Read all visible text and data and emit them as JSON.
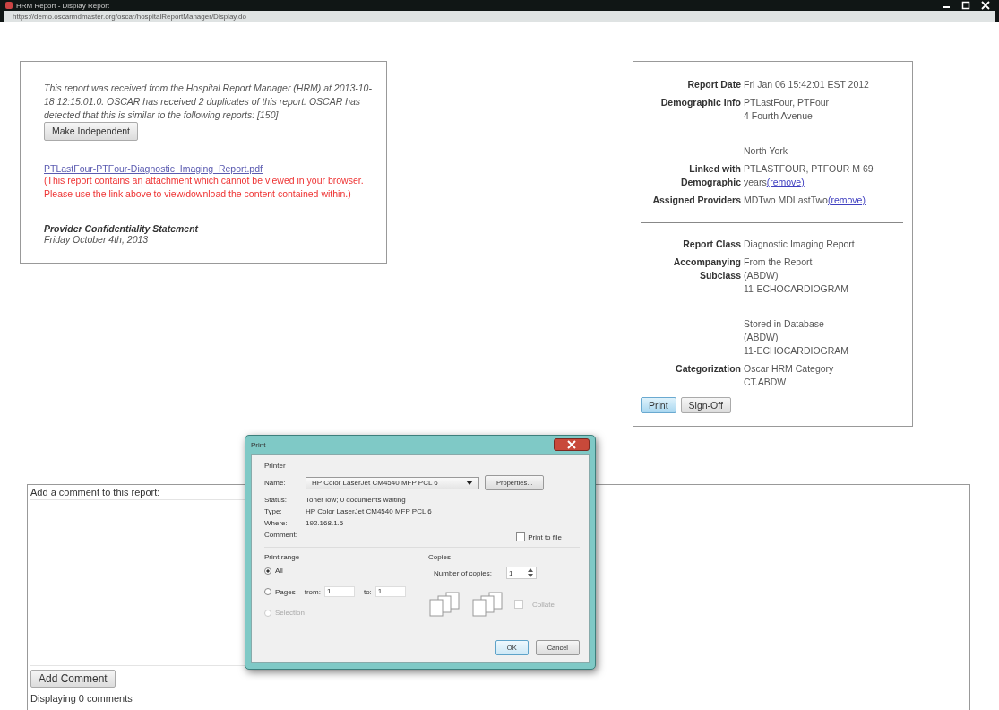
{
  "window": {
    "title": "HRM Report - Display Report",
    "url": "https://demo.oscarmdmaster.org/oscar/hospitalReportManager/Display.do"
  },
  "report": {
    "intro": "This report was received from the Hospital Report Manager (HRM) at 2013-10-18 12:15:01.0. OSCAR has received 2 duplicates of this report. OSCAR has detected that this is similar to the following reports: [150]",
    "make_independent_button": "Make Independent",
    "attachment_link": "PTLastFour-PTFour-Diagnostic_Imaging_Report.pdf",
    "attachment_warning": "(This report contains an attachment which cannot be viewed in your browser. Please use the link above to view/download the content contained within.)",
    "confidentiality_title": "Provider Confidentiality Statement",
    "confidentiality_date": "Friday October 4th, 2013"
  },
  "details": {
    "rows": [
      {
        "label": "Report Date",
        "blocks": [
          [
            "Fri Jan 06 15:42:01 EST 2012"
          ]
        ]
      },
      {
        "label": "Demographic Info",
        "blocks": [
          [
            "PTLastFour, PTFour",
            "4 Fourth Avenue"
          ],
          [
            "North York"
          ]
        ]
      },
      {
        "label": "Linked with Demographic",
        "blocks": [
          [
            "PTLASTFOUR, PTFOUR M 69",
            "years"
          ]
        ],
        "link": "(remove)"
      },
      {
        "label": "Assigned Providers",
        "blocks": [
          [
            "MDTwo MDLastTwo"
          ]
        ],
        "link": "(remove)"
      }
    ],
    "class_rows": [
      {
        "label": "Report Class",
        "blocks": [
          [
            "Diagnostic Imaging Report"
          ]
        ]
      },
      {
        "label": "Accompanying Subclass",
        "blocks": [
          [
            "From the Report",
            "(ABDW)",
            "11-ECHOCARDIOGRAM"
          ],
          [
            "Stored in Database",
            "(ABDW)",
            "11-ECHOCARDIOGRAM"
          ]
        ]
      },
      {
        "label": "Categorization",
        "blocks": [
          [
            "Oscar HRM Category",
            "CT.ABDW"
          ]
        ]
      }
    ],
    "buttons": [
      {
        "label": "Print",
        "selected": true
      },
      {
        "label": "Sign-Off",
        "selected": false
      }
    ]
  },
  "comments": {
    "label": "Add a comment to this report:",
    "button": "Add Comment",
    "footer": "Displaying 0 comments"
  },
  "print_dialog": {
    "title": "Print",
    "printer_group": "Printer",
    "name_label": "Name:",
    "name_value": "HP Color LaserJet CM4540 MFP PCL 6",
    "properties_button": "Properties...",
    "info": [
      {
        "label": "Status:",
        "value": "Toner low; 0 documents waiting"
      },
      {
        "label": "Type:",
        "value": "HP Color LaserJet CM4540 MFP PCL 6"
      },
      {
        "label": "Where:",
        "value": "192.168.1.5"
      },
      {
        "label": "Comment:"
      }
    ],
    "print_to_file": {
      "label": "Print to file",
      "checked": false
    },
    "range_group": "Print range",
    "range_options": [
      {
        "label": "All",
        "selected": true,
        "disabled": false
      },
      {
        "label": "Pages",
        "selected": false,
        "disabled": false
      },
      {
        "label": "Selection",
        "selected": false,
        "disabled": true
      }
    ],
    "from_label": "from:",
    "from_value": "1",
    "to_label": "to:",
    "to_value": "1",
    "copies_group": "Copies",
    "copies_label": "Number of copies:",
    "copies_value": "1",
    "collate": {
      "label": "Collate",
      "checked": false,
      "disabled": true
    },
    "ok_button": "OK",
    "cancel_button": "Cancel"
  }
}
